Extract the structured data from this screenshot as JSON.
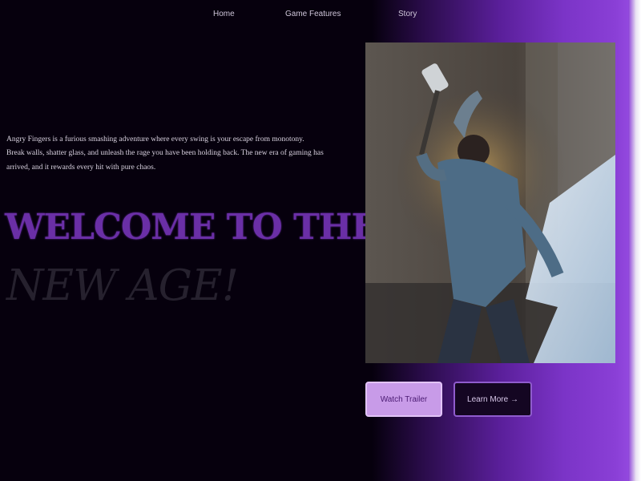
{
  "nav": {
    "items": [
      {
        "label": "Home"
      },
      {
        "label": "Game Features"
      },
      {
        "label": "Story"
      }
    ]
  },
  "hero": {
    "intro": "Angry Fingers is a furious smashing adventure where every swing is your escape from monotony. Break walls, shatter glass, and unleash the rage you have been holding back. The new era of gaming has arrived, and it rewards every hit with pure chaos.",
    "headline_line1": "WELCOME TO THE",
    "headline_line2": "NEW AGE!"
  },
  "actions": {
    "primary_label": "Watch Trailer",
    "secondary_label": "Learn More →"
  },
  "colors": {
    "background": "#07010f",
    "accent_purple": "#7b34c7",
    "headline_purple": "#6a2fa6",
    "button_fill": "#c89be8"
  }
}
